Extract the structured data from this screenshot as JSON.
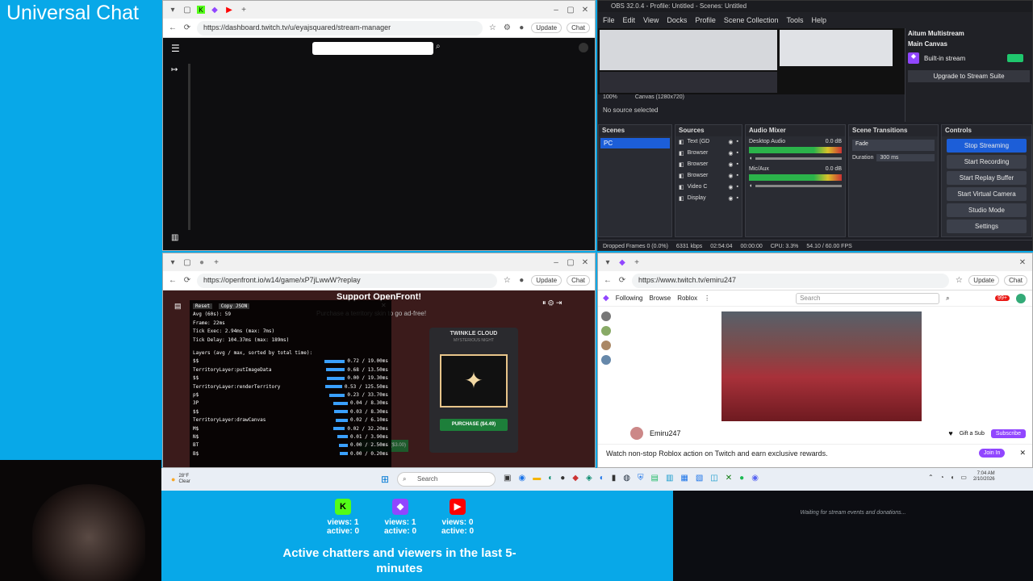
{
  "universal_chat": {
    "title": "Universal Chat"
  },
  "browser_dash": {
    "url": "https://dashboard.twitch.tv/u/eyajsquared/stream-manager",
    "update_label": "Update",
    "chat_label": "Chat"
  },
  "browser_openfront": {
    "url": "https://openfront.io/w14/game/xP7jLwwW?replay",
    "update_label": "Update",
    "chat_label": "Chat",
    "support_title": "Support OpenFront!",
    "support_sub": "Purchase a territory skin to go ad-free!",
    "skin_name": "TWINKLE CLOUD",
    "skin_sub": "MYSTERIOUS NIGHT",
    "purchase_left": "PURCHASE ($3.00)",
    "purchase_right": "PURCHASE ($4.49)",
    "perf": {
      "reset": "Reset",
      "copy": "Copy JSON",
      "avg_fps": "Avg (60s): 59",
      "frame": "Frame: 22ms",
      "tick_exec": "Tick Exec: 2.94ms (max: 7ms)",
      "tick_delay": "Tick Delay: 104.37ms (max: 189ms)",
      "layers_header": "Layers (avg / max, sorted by total time):",
      "layers": [
        {
          "name": "$$",
          "value": "0.72 / 19.00ms",
          "pct": 0.9
        },
        {
          "name": "TerritoryLayer:putImageData",
          "value": "0.68 / 13.50ms",
          "pct": 0.85
        },
        {
          "name": "$$",
          "value": "0.00 / 19.30ms",
          "pct": 0.8
        },
        {
          "name": "TerritoryLayer:renderTerritory",
          "value": "0.53 / 125.50ms",
          "pct": 0.75
        },
        {
          "name": "p$",
          "value": "0.23 / 33.70ms",
          "pct": 0.7
        },
        {
          "name": "3P",
          "value": "0.04 / 8.30ms",
          "pct": 0.65
        },
        {
          "name": "$$",
          "value": "0.03 / 8.30ms",
          "pct": 0.6
        },
        {
          "name": "TerritoryLayer:drawCanvas",
          "value": "0.02 / 6.10ms",
          "pct": 0.55
        },
        {
          "name": "M$",
          "value": "0.02 / 32.20ms",
          "pct": 0.5
        },
        {
          "name": "N$",
          "value": "0.01 / 3.90ms",
          "pct": 0.45
        },
        {
          "name": "BT",
          "value": "0.00 / 2.50ms",
          "pct": 0.4
        },
        {
          "name": "B$",
          "value": "0.00 / 0.20ms",
          "pct": 0.35
        }
      ]
    }
  },
  "obs": {
    "title": "OBS 32.0.4 - Profile: Untitled - Scenes: Untitled",
    "menu": [
      "File",
      "Edit",
      "View",
      "Docks",
      "Profile",
      "Scene Collection",
      "Tools",
      "Help"
    ],
    "multistream_title": "Aitum Multistream",
    "main_canvas": "Main Canvas",
    "built_in_stream": "Built-in stream",
    "upgrade": "Upgrade to Stream Suite",
    "no_source": "No source selected",
    "canvas_label": "Canvas (1280x720)",
    "zoom": "100%",
    "scenes_header": "Scenes",
    "scenes": [
      "PC"
    ],
    "sources_header": "Sources",
    "sources": [
      "Text (GD",
      "Browser",
      "Browser",
      "Browser",
      "Video C",
      "Display"
    ],
    "mixer_header": "Audio Mixer",
    "mixer": [
      {
        "name": "Desktop Audio",
        "db": "0.0 dB"
      },
      {
        "name": "Mic/Aux",
        "db": "0.0 dB"
      }
    ],
    "transitions_header": "Scene Transitions",
    "transition": "Fade",
    "duration_label": "Duration",
    "duration_value": "300 ms",
    "controls_header": "Controls",
    "controls": [
      "Stop Streaming",
      "Start Recording",
      "Start Replay Buffer",
      "Start Virtual Camera",
      "Studio Mode",
      "Settings"
    ],
    "status": {
      "dropped": "Dropped Frames 0 (0.0%)",
      "kbps": "6331 kbps",
      "live": "02:54:04",
      "rec": "00:00:00",
      "cpu": "CPU: 3.3%",
      "fps": "54.10 / 60.00 FPS"
    }
  },
  "browser_twitch": {
    "url": "https://www.twitch.tv/emiru247",
    "update_label": "Update",
    "chat_label": "Chat",
    "nav": [
      "Following",
      "Browse",
      "Roblox"
    ],
    "search_placeholder": "Search",
    "badge": "99+",
    "streamer": "Emiru247",
    "gift": "Gift a Sub",
    "subscribe": "Subscribe",
    "promo": "Watch non-stop Roblox action on Twitch and earn exclusive rewards.",
    "join": "Join In"
  },
  "taskbar": {
    "weather_temp": "28°F",
    "weather_text": "Clear",
    "search": "Search",
    "time": "7:04 AM",
    "date": "2/10/2026"
  },
  "stats": {
    "platforms": [
      {
        "name": "kick",
        "views": "views: 1",
        "active": "active: 0",
        "color": "#53fc18",
        "icon": "kick-icon"
      },
      {
        "name": "twitch",
        "views": "views: 1",
        "active": "active: 0",
        "color": "#9146ff",
        "icon": "twitch-icon"
      },
      {
        "name": "youtube",
        "views": "views: 0",
        "active": "active: 0",
        "color": "#ff0000",
        "icon": "youtube-icon"
      }
    ],
    "caption": "Active chatters and viewers in the last 5-minutes"
  },
  "events": {
    "text": "Waiting for stream events and donations..."
  }
}
